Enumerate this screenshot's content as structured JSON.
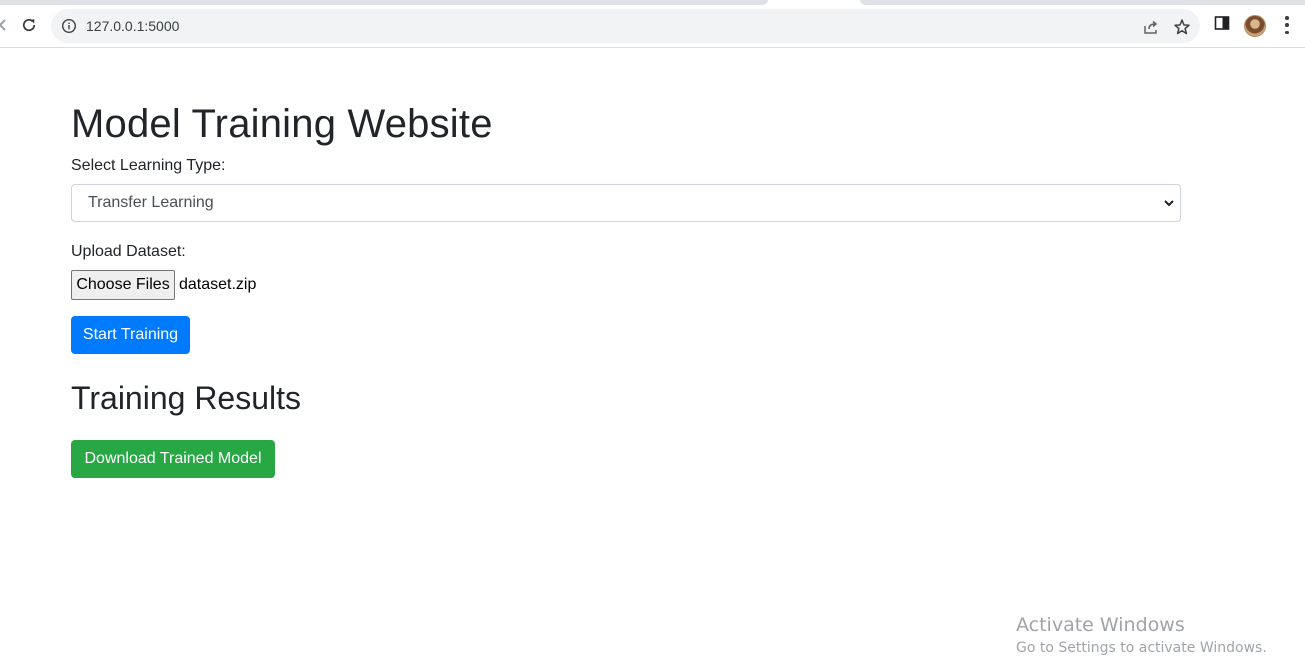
{
  "browser": {
    "url": "127.0.0.1:5000",
    "icons": {
      "back": "back-arrow-icon",
      "reload": "reload-icon",
      "site_info": "info-icon",
      "share": "share-icon",
      "bookmark": "star-icon",
      "side_panel": "side-panel-icon",
      "profile": "avatar",
      "menu": "more-vert-icon"
    }
  },
  "page": {
    "title": "Model Training Website",
    "learning_type_label": "Select Learning Type:",
    "learning_type_value": "Transfer Learning",
    "upload_label": "Upload Dataset:",
    "choose_files_label": "Choose Files",
    "selected_file": "dataset.zip",
    "start_training_label": "Start Training",
    "results_title": "Training Results",
    "download_label": "Download Trained Model"
  },
  "watermark": {
    "title": "Activate Windows",
    "subtitle": "Go to Settings to activate Windows."
  },
  "colors": {
    "primary": "#007bff",
    "success": "#28a745",
    "text": "#212529"
  }
}
